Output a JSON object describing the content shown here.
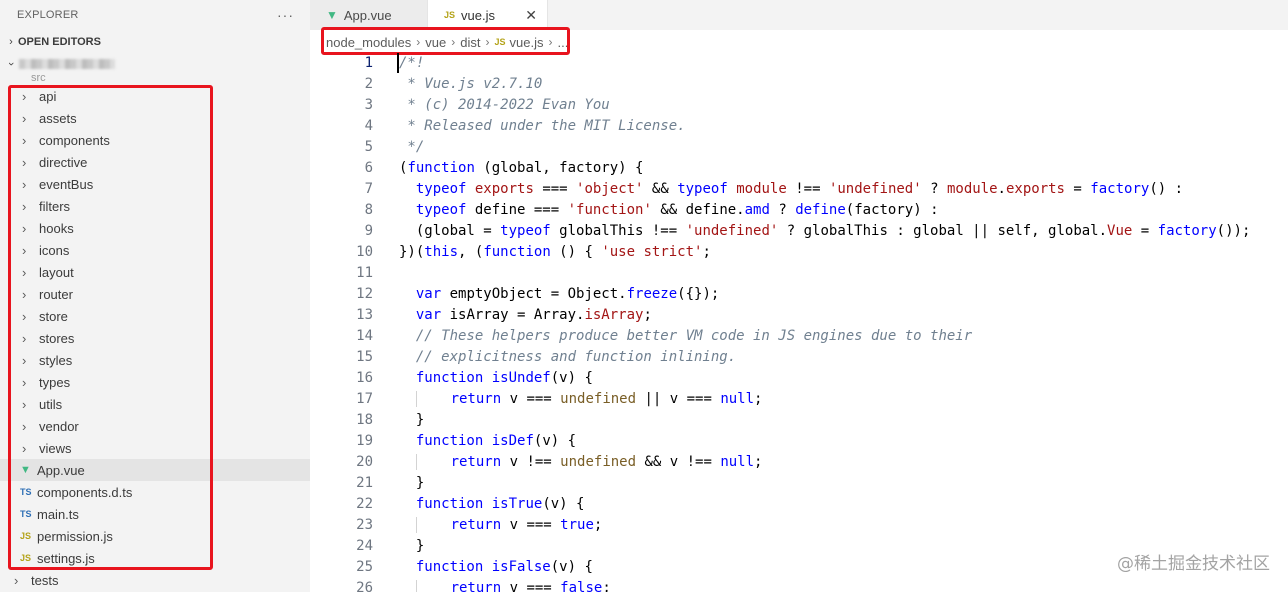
{
  "sidebar": {
    "title": "EXPLORER",
    "more": "···",
    "open_editors": "OPEN EDITORS",
    "src_label": "src",
    "folders": [
      "api",
      "assets",
      "components",
      "directive",
      "eventBus",
      "filters",
      "hooks",
      "icons",
      "layout",
      "router",
      "store",
      "stores",
      "styles",
      "types",
      "utils",
      "vendor",
      "views"
    ],
    "files": [
      {
        "name": "App.vue",
        "icon": "vue-icon",
        "badge": "▼"
      },
      {
        "name": "components.d.ts",
        "icon": "ts-icon",
        "badge": "TS"
      },
      {
        "name": "main.ts",
        "icon": "ts-icon",
        "badge": "TS"
      },
      {
        "name": "permission.js",
        "icon": "js-icon",
        "badge": "JS"
      },
      {
        "name": "settings.js",
        "icon": "js-icon",
        "badge": "JS"
      }
    ],
    "tests": "tests"
  },
  "tabs": [
    {
      "label": "App.vue",
      "badge": "▼",
      "active": false
    },
    {
      "label": "vue.js",
      "badge": "JS",
      "active": true,
      "close": "✕"
    }
  ],
  "breadcrumb": {
    "parts": [
      "node_modules",
      "vue",
      "dist"
    ],
    "file_badge": "JS",
    "file": "vue.js",
    "ellipsis": "..."
  },
  "code": {
    "line_numbers": [
      "1",
      "2",
      "3",
      "4",
      "5",
      "6",
      "7",
      "8",
      "9",
      "10",
      "11",
      "12",
      "13",
      "14",
      "15",
      "16",
      "17",
      "18",
      "19",
      "20",
      "21",
      "22",
      "23",
      "24",
      "25",
      "26"
    ],
    "lines": [
      [
        [
          "/*!",
          "com"
        ]
      ],
      [
        [
          " * Vue.js v2.7.10",
          "com"
        ]
      ],
      [
        [
          " * (c) 2014-2022 Evan You",
          "com"
        ]
      ],
      [
        [
          " * Released under the MIT License.",
          "com"
        ]
      ],
      [
        [
          " */",
          "com"
        ]
      ],
      [
        [
          "(",
          "txt"
        ],
        [
          "function",
          "kw"
        ],
        [
          " (global, factory) {",
          "txt"
        ]
      ],
      [
        [
          "  ",
          "txt"
        ],
        [
          "typeof",
          "kw"
        ],
        [
          " ",
          "txt"
        ],
        [
          "exports",
          "red"
        ],
        [
          " === ",
          "txt"
        ],
        [
          "'object'",
          "str"
        ],
        [
          " && ",
          "txt"
        ],
        [
          "typeof",
          "kw"
        ],
        [
          " ",
          "txt"
        ],
        [
          "module",
          "red"
        ],
        [
          " !== ",
          "txt"
        ],
        [
          "'undefined'",
          "str"
        ],
        [
          " ? ",
          "txt"
        ],
        [
          "module",
          "red"
        ],
        [
          ".",
          "txt"
        ],
        [
          "exports",
          "red"
        ],
        [
          " = ",
          "txt"
        ],
        [
          "factory",
          "kw"
        ],
        [
          "() :",
          "txt"
        ]
      ],
      [
        [
          "  ",
          "txt"
        ],
        [
          "typeof",
          "kw"
        ],
        [
          " define === ",
          "txt"
        ],
        [
          "'function'",
          "str"
        ],
        [
          " && define.",
          "txt"
        ],
        [
          "amd",
          "kw"
        ],
        [
          " ? ",
          "txt"
        ],
        [
          "define",
          "kw"
        ],
        [
          "(factory) :",
          "txt"
        ]
      ],
      [
        [
          "  (global = ",
          "txt"
        ],
        [
          "typeof",
          "kw"
        ],
        [
          " globalThis !== ",
          "txt"
        ],
        [
          "'undefined'",
          "str"
        ],
        [
          " ? globalThis : global || self, global.",
          "txt"
        ],
        [
          "Vue",
          "red"
        ],
        [
          " = ",
          "txt"
        ],
        [
          "factory",
          "kw"
        ],
        [
          "());",
          "txt"
        ]
      ],
      [
        [
          "})(",
          "txt"
        ],
        [
          "this",
          "kw"
        ],
        [
          ", (",
          "txt"
        ],
        [
          "function",
          "kw"
        ],
        [
          " () { ",
          "txt"
        ],
        [
          "'use strict'",
          "str"
        ],
        [
          ";",
          "txt"
        ]
      ],
      [
        [
          "",
          "txt"
        ]
      ],
      [
        [
          "  ",
          "txt"
        ],
        [
          "var",
          "kw"
        ],
        [
          " emptyObject = Object.",
          "txt"
        ],
        [
          "freeze",
          "kw"
        ],
        [
          "({});",
          "txt"
        ]
      ],
      [
        [
          "  ",
          "txt"
        ],
        [
          "var",
          "kw"
        ],
        [
          " isArray = Array.",
          "txt"
        ],
        [
          "isArray",
          "red"
        ],
        [
          ";",
          "txt"
        ]
      ],
      [
        [
          "  // These helpers produce better VM code in JS engines due to their",
          "com"
        ]
      ],
      [
        [
          "  // explicitness and function inlining.",
          "com"
        ]
      ],
      [
        [
          "  ",
          "txt"
        ],
        [
          "function",
          "kw"
        ],
        [
          " ",
          "txt"
        ],
        [
          "isUndef",
          "kw"
        ],
        [
          "(v) {",
          "txt"
        ]
      ],
      [
        [
          "  ",
          "guide"
        ],
        [
          "    ",
          "txt"
        ],
        [
          "return",
          "kw"
        ],
        [
          " v === ",
          "txt"
        ],
        [
          "undefined",
          "fn"
        ],
        [
          " || v === ",
          "txt"
        ],
        [
          "null",
          "kw"
        ],
        [
          ";",
          "txt"
        ]
      ],
      [
        [
          "  }",
          "txt"
        ]
      ],
      [
        [
          "  ",
          "txt"
        ],
        [
          "function",
          "kw"
        ],
        [
          " ",
          "txt"
        ],
        [
          "isDef",
          "kw"
        ],
        [
          "(v) {",
          "txt"
        ]
      ],
      [
        [
          "  ",
          "guide"
        ],
        [
          "    ",
          "txt"
        ],
        [
          "return",
          "kw"
        ],
        [
          " v !== ",
          "txt"
        ],
        [
          "undefined",
          "fn"
        ],
        [
          " && v !== ",
          "txt"
        ],
        [
          "null",
          "kw"
        ],
        [
          ";",
          "txt"
        ]
      ],
      [
        [
          "  }",
          "txt"
        ]
      ],
      [
        [
          "  ",
          "txt"
        ],
        [
          "function",
          "kw"
        ],
        [
          " ",
          "txt"
        ],
        [
          "isTrue",
          "kw"
        ],
        [
          "(v) {",
          "txt"
        ]
      ],
      [
        [
          "  ",
          "guide"
        ],
        [
          "    ",
          "txt"
        ],
        [
          "return",
          "kw"
        ],
        [
          " v === ",
          "txt"
        ],
        [
          "true",
          "kw"
        ],
        [
          ";",
          "txt"
        ]
      ],
      [
        [
          "  }",
          "txt"
        ]
      ],
      [
        [
          "  ",
          "txt"
        ],
        [
          "function",
          "kw"
        ],
        [
          " ",
          "txt"
        ],
        [
          "isFalse",
          "kw"
        ],
        [
          "(v) {",
          "txt"
        ]
      ],
      [
        [
          "  ",
          "guide"
        ],
        [
          "    ",
          "txt"
        ],
        [
          "return",
          "kw"
        ],
        [
          " v === ",
          "txt"
        ],
        [
          "false",
          "kw"
        ],
        [
          ";",
          "txt"
        ]
      ]
    ]
  },
  "watermark": "@稀土掘金技术社区",
  "colors": {
    "highlight_box": "#e8141e",
    "keyword": "#0000ff",
    "string": "#a31515",
    "comment": "#708090",
    "sidebar_bg": "#f3f3f3"
  }
}
